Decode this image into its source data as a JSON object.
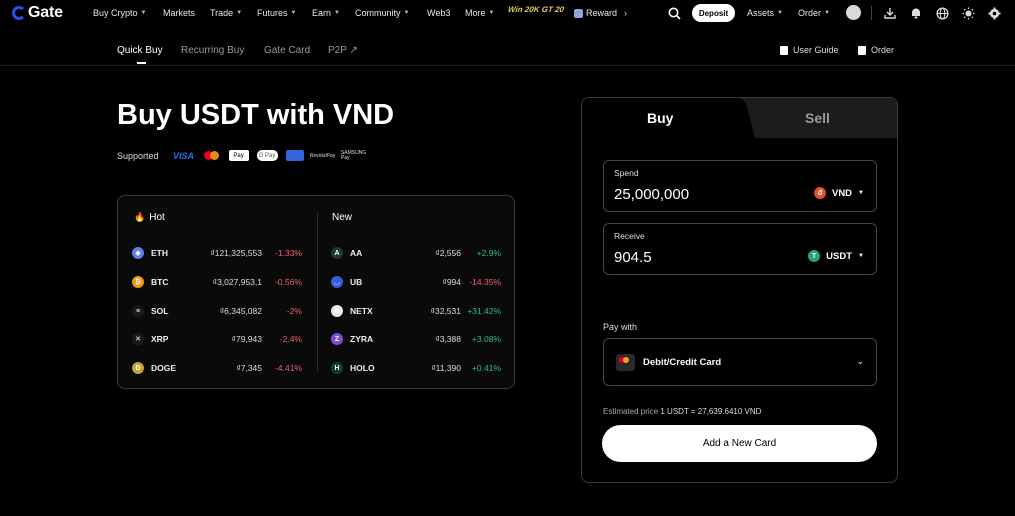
{
  "brand": {
    "logo_text": "Gate"
  },
  "topnav": {
    "items": [
      {
        "label": "Buy Crypto",
        "dropdown": true
      },
      {
        "label": "Markets",
        "dropdown": false
      },
      {
        "label": "Trade",
        "dropdown": true
      },
      {
        "label": "Futures",
        "dropdown": true
      },
      {
        "label": "Earn",
        "dropdown": true
      },
      {
        "label": "Community",
        "dropdown": true
      },
      {
        "label": "Web3",
        "dropdown": false
      },
      {
        "label": "More",
        "dropdown": true
      }
    ],
    "promo_text": "Win 20K GT 20",
    "reward_label": "Reward",
    "deposit_label": "Deposit",
    "assets_label": "Assets",
    "order_label": "Order",
    "icons": [
      "search-icon",
      "download-icon",
      "bell-icon",
      "globe-icon",
      "theme-icon",
      "settings-icon"
    ]
  },
  "subnav": {
    "tabs": [
      {
        "label": "Quick Buy",
        "active": true
      },
      {
        "label": "Recurring Buy",
        "active": false
      },
      {
        "label": "Gate Card",
        "active": false
      },
      {
        "label": "P2P ↗",
        "active": false
      }
    ],
    "user_guide_label": "User Guide",
    "order_label": "Order"
  },
  "hero": {
    "title": "Buy USDT with VND",
    "supported_label": "Supported",
    "payment_logos": {
      "visa": "VISA",
      "apple_pay": "Pay",
      "google_pay": "G Pay",
      "revolut_pay": "RevolutPay",
      "samsung_pay": "SAMSUNG Pay"
    }
  },
  "markets": {
    "hot_title": "Hot",
    "new_title": "New",
    "hot": [
      {
        "symbol": "ETH",
        "price": "₫121,325,553",
        "change": "-1.33%",
        "dir": "neg",
        "color": "#627eea",
        "glyph": "◆"
      },
      {
        "symbol": "BTC",
        "price": "₫3,027,953,1",
        "change": "-0.56%",
        "dir": "neg",
        "color": "#f7931a",
        "glyph": "₿"
      },
      {
        "symbol": "SOL",
        "price": "₫6,345,082",
        "change": "-2%",
        "dir": "neg",
        "color": "#1a1a1a",
        "glyph": "≡"
      },
      {
        "symbol": "XRP",
        "price": "₫79,943",
        "change": "-2.4%",
        "dir": "neg",
        "color": "#1a1a1a",
        "glyph": "✕"
      },
      {
        "symbol": "DOGE",
        "price": "₫7,345",
        "change": "-4.41%",
        "dir": "neg",
        "color": "#c2a633",
        "glyph": "Ð"
      }
    ],
    "new": [
      {
        "symbol": "AA",
        "price": "₫2,556",
        "change": "+2.9%",
        "dir": "pos",
        "color": "#1d3b2a",
        "glyph": "A"
      },
      {
        "symbol": "UB",
        "price": "₫994",
        "change": "-14.35%",
        "dir": "neg",
        "color": "#3b5bdb",
        "glyph": "◡"
      },
      {
        "symbol": "NETX",
        "price": "₫32,531",
        "change": "+31.42%",
        "dir": "pos",
        "color": "#e9e9e9",
        "glyph": "N"
      },
      {
        "symbol": "ZYRA",
        "price": "₫3,388",
        "change": "+3.08%",
        "dir": "pos",
        "color": "#7b4fd6",
        "glyph": "Z"
      },
      {
        "symbol": "HOLO",
        "price": "₫11,390",
        "change": "+0.41%",
        "dir": "pos",
        "color": "#0f3d3a",
        "glyph": "H"
      }
    ]
  },
  "trade": {
    "tab_buy": "Buy",
    "tab_sell": "Sell",
    "spend_label": "Spend",
    "spend_value": "25,000,000",
    "spend_currency": "VND",
    "spend_currency_color": "#e0512b",
    "receive_label": "Receive",
    "receive_value": "904.5",
    "receive_currency": "USDT",
    "receive_currency_color": "#26a17b",
    "pay_with_label": "Pay with",
    "pay_method": "Debit/Credit Card",
    "estimated_label": "Estimated price",
    "estimated_value": "1 USDT = 27,639.6410 VND",
    "add_card_label": "Add a New Card"
  }
}
